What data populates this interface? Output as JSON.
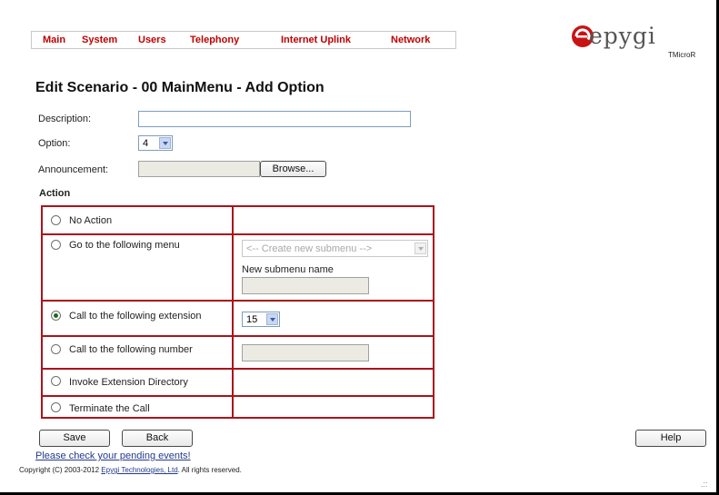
{
  "nav": {
    "items": [
      "Main",
      "System",
      "Users",
      "Telephony",
      "Internet Uplink",
      "Network"
    ]
  },
  "logo": {
    "brand": "epygi",
    "model": "TMicroR"
  },
  "page_title": "Edit Scenario - 00 MainMenu - Add Option",
  "form": {
    "description_label": "Description:",
    "description_value": "",
    "option_label": "Option:",
    "option_value": "4",
    "announcement_label": "Announcement:",
    "browse_label": "Browse..."
  },
  "action": {
    "heading": "Action",
    "options": [
      {
        "label": "No Action",
        "checked": false
      },
      {
        "label": "Go to the following menu",
        "checked": false
      },
      {
        "label": "Call to the following extension",
        "checked": true
      },
      {
        "label": "Call to the following number",
        "checked": false
      },
      {
        "label": "Invoke Extension Directory",
        "checked": false
      },
      {
        "label": "Terminate the Call",
        "checked": false
      }
    ],
    "submenu_select": "<-- Create new submenu -->",
    "new_submenu_label": "New submenu name",
    "extension_value": "15"
  },
  "buttons": {
    "save": "Save",
    "back": "Back",
    "help": "Help"
  },
  "footer": {
    "pending_link": "Please check your pending events!",
    "copyright_prefix": "Copyright (C) 2003-2012 ",
    "copyright_link": "Epygi Technologies, Ltd",
    "copyright_suffix": ". All rights reserved.",
    "resize_glyph": ".::"
  }
}
